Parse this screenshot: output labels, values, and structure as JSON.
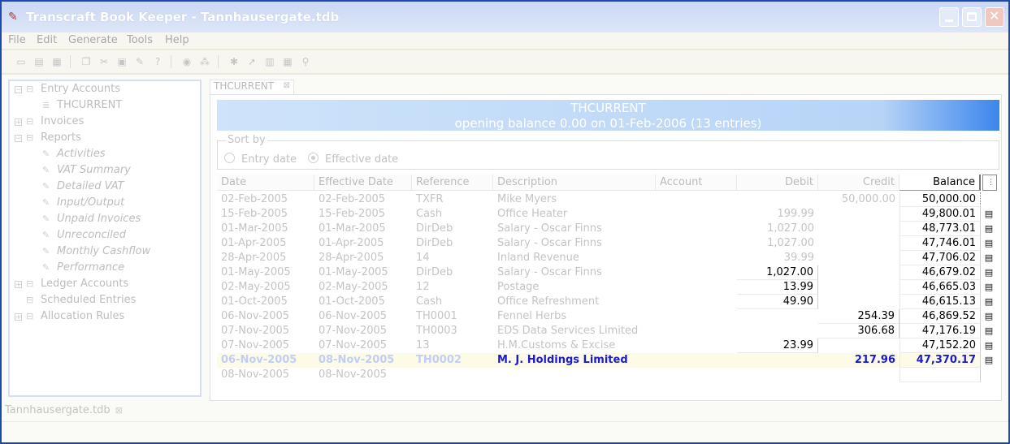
{
  "window": {
    "title": "Transcraft Book Keeper - Tannhausergate.tdb"
  },
  "menu": [
    "File",
    "Edit",
    "Generate",
    "Tools",
    "Help"
  ],
  "toolbar": {
    "groups": [
      [
        "new-file-icon",
        "open-file-icon",
        "save-file-icon"
      ],
      [
        "copy-icon",
        "cut-icon",
        "paste-icon",
        "edit-icon",
        "help-icon"
      ],
      [
        "globe-icon",
        "pdf-icon"
      ],
      [
        "bug-icon",
        "cursor-icon",
        "chart-icon",
        "table-icon",
        "key-icon"
      ]
    ]
  },
  "tree": {
    "items": [
      {
        "label": "Entry Accounts",
        "level": 0,
        "expander": "−",
        "icon": "folder-icon",
        "italic": false
      },
      {
        "label": "THCURRENT",
        "level": 1,
        "expander": "",
        "icon": "ledger-icon",
        "italic": false
      },
      {
        "label": "Invoices",
        "level": 0,
        "expander": "+",
        "icon": "folder-icon",
        "italic": false
      },
      {
        "label": "Reports",
        "level": 0,
        "expander": "−",
        "icon": "folder-icon",
        "italic": false
      },
      {
        "label": "Activities",
        "level": 1,
        "expander": "",
        "icon": "report-icon",
        "italic": true
      },
      {
        "label": "VAT Summary",
        "level": 1,
        "expander": "",
        "icon": "report-icon",
        "italic": true
      },
      {
        "label": "Detailed VAT",
        "level": 1,
        "expander": "",
        "icon": "report-icon",
        "italic": true
      },
      {
        "label": "Input/Output",
        "level": 1,
        "expander": "",
        "icon": "report-icon",
        "italic": true
      },
      {
        "label": "Unpaid Invoices",
        "level": 1,
        "expander": "",
        "icon": "report-icon",
        "italic": true
      },
      {
        "label": "Unreconciled",
        "level": 1,
        "expander": "",
        "icon": "report-icon",
        "italic": true
      },
      {
        "label": "Monthly Cashflow",
        "level": 1,
        "expander": "",
        "icon": "report-icon",
        "italic": true
      },
      {
        "label": "Performance",
        "level": 1,
        "expander": "",
        "icon": "report-icon",
        "italic": true
      },
      {
        "label": "Ledger Accounts",
        "level": 0,
        "expander": "+",
        "icon": "folder-icon",
        "italic": false
      },
      {
        "label": "Scheduled Entries",
        "level": 0,
        "expander": "",
        "icon": "folder-icon",
        "italic": false
      },
      {
        "label": "Allocation Rules",
        "level": 0,
        "expander": "+",
        "icon": "folder-icon",
        "italic": false
      }
    ]
  },
  "editor_tab": {
    "label": "THCURRENT"
  },
  "banner": {
    "title": "THCURRENT",
    "subtitle": "opening balance 0.00 on 01-Feb-2006 (13 entries)"
  },
  "sort": {
    "legend": "Sort by",
    "options": [
      "Entry date",
      "Effective date"
    ],
    "selected": "Effective date"
  },
  "columns": [
    "Date",
    "Effective Date",
    "Reference",
    "Description",
    "Account",
    "Debit",
    "Credit",
    "Balance"
  ],
  "rows": [
    {
      "date": "02-Feb-2005",
      "eff": "02-Feb-2005",
      "ref": "TXFR",
      "desc": "Mike Myers",
      "account": "",
      "debit": "",
      "credit": "50,000.00",
      "balance": "50,000.00",
      "icon": false
    },
    {
      "date": "15-Feb-2005",
      "eff": "15-Feb-2005",
      "ref": "Cash",
      "desc": "Office Heater",
      "account": "",
      "debit": "199.99",
      "credit": "",
      "balance": "49,800.01",
      "icon": true
    },
    {
      "date": "01-Mar-2005",
      "eff": "01-Mar-2005",
      "ref": "DirDeb",
      "desc": "Salary - Oscar Finns",
      "account": "",
      "debit": "1,027.00",
      "credit": "",
      "balance": "48,773.01",
      "icon": true
    },
    {
      "date": "01-Apr-2005",
      "eff": "01-Apr-2005",
      "ref": "DirDeb",
      "desc": "Salary - Oscar Finns",
      "account": "",
      "debit": "1,027.00",
      "credit": "",
      "balance": "47,746.01",
      "icon": true
    },
    {
      "date": "28-Apr-2005",
      "eff": "28-Apr-2005",
      "ref": "14",
      "desc": "Inland Revenue",
      "account": "",
      "debit": "39.99",
      "credit": "",
      "balance": "47,706.02",
      "icon": true
    },
    {
      "date": "01-May-2005",
      "eff": "01-May-2005",
      "ref": "DirDeb",
      "desc": "Salary - Oscar Finns",
      "account": "",
      "debit": "1,027.00",
      "credit": "",
      "balance": "46,679.02",
      "icon": true
    },
    {
      "date": "02-May-2005",
      "eff": "02-May-2005",
      "ref": "12",
      "desc": "Postage",
      "account": "",
      "debit": "13.99",
      "credit": "",
      "balance": "46,665.03",
      "icon": true
    },
    {
      "date": "01-Oct-2005",
      "eff": "01-Oct-2005",
      "ref": "Cash",
      "desc": "Office Refreshment",
      "account": "",
      "debit": "49.90",
      "credit": "",
      "balance": "46,615.13",
      "icon": true
    },
    {
      "date": "06-Nov-2005",
      "eff": "06-Nov-2005",
      "ref": "TH0001",
      "desc": "Fennel Herbs",
      "account": "",
      "debit": "",
      "credit": "254.39",
      "balance": "46,869.52",
      "icon": true
    },
    {
      "date": "07-Nov-2005",
      "eff": "07-Nov-2005",
      "ref": "TH0003",
      "desc": "EDS Data Services Limited",
      "account": "",
      "debit": "",
      "credit": "306.68",
      "balance": "47,176.19",
      "icon": true
    },
    {
      "date": "07-Nov-2005",
      "eff": "07-Nov-2005",
      "ref": "13",
      "desc": "H.M.Customs & Excise",
      "account": "",
      "debit": "23.99",
      "credit": "",
      "balance": "47,152.20",
      "icon": true
    },
    {
      "date": "06-Nov-2005",
      "eff": "08-Nov-2005",
      "ref": "TH0002",
      "desc": "M. J. Holdings Limited",
      "account": "",
      "debit": "",
      "credit": "217.96",
      "balance": "47,370.17",
      "icon": true,
      "highlight": true
    },
    {
      "date": "08-Nov-2005",
      "eff": "08-Nov-2005",
      "ref": "",
      "desc": "",
      "account": "",
      "debit": "",
      "credit": "",
      "balance": "",
      "icon": false
    }
  ],
  "bottom_tab": {
    "label": "Tannhausergate.tdb"
  }
}
